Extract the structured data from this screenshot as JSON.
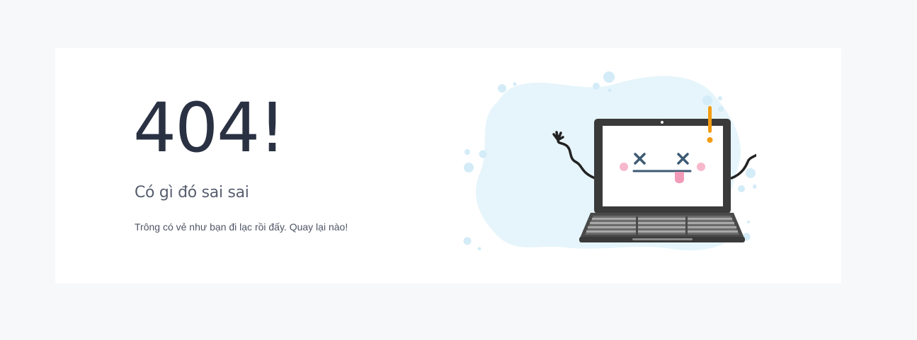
{
  "error": {
    "code": "404!",
    "headline": "Có gì đó sai sai",
    "message": "Trông có vẻ như bạn đi lạc rồi đấy. Quay lại nào!"
  },
  "illustration": {
    "subject": "broken-laptop-icon",
    "colors": {
      "blob": "#e6f5fb",
      "bubbles": "#d4ecf7",
      "laptop_body": "#3a3a3a",
      "screen": "#ffffff",
      "face": "#3d5a73",
      "cheeks": "#f7b8cc",
      "tongue": "#f29bb8",
      "exclamation": "#f39c12"
    }
  }
}
